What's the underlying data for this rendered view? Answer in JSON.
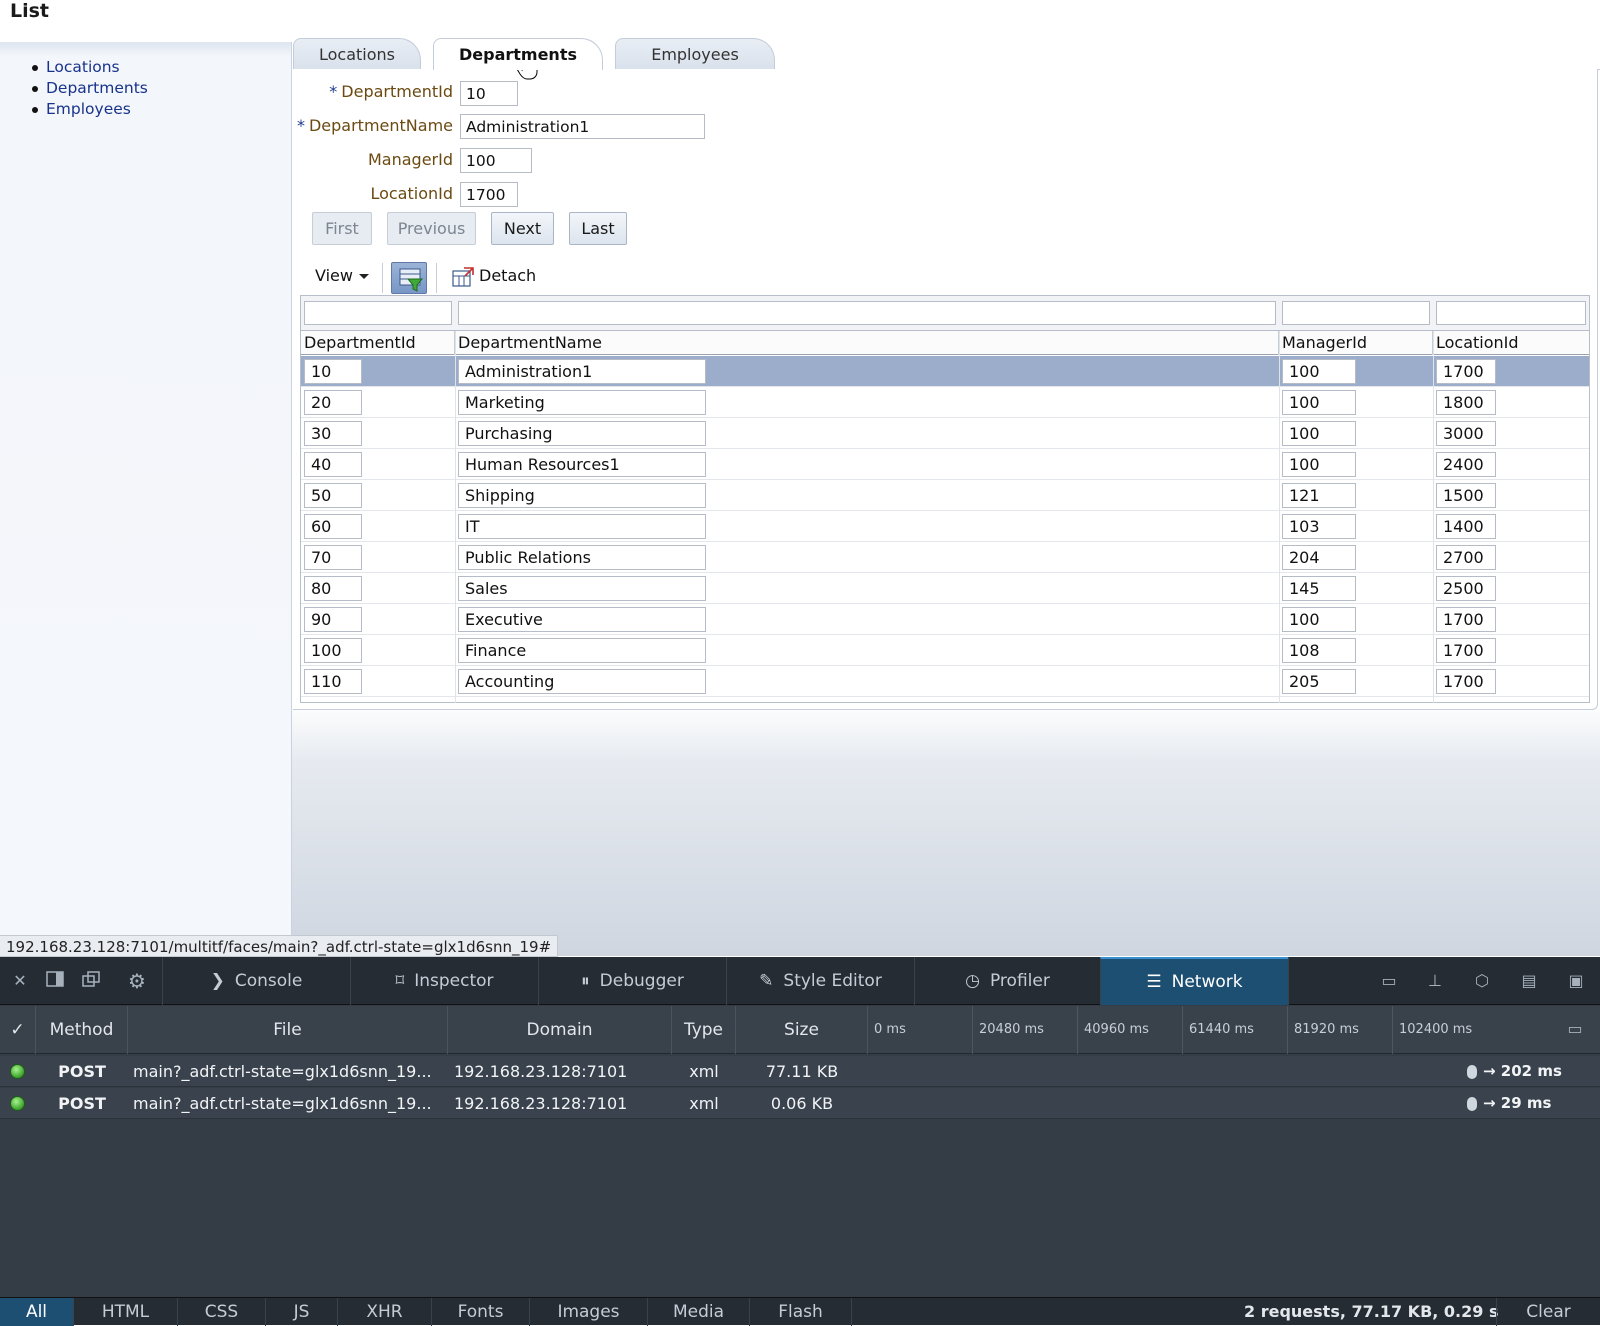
{
  "page": {
    "title": "List"
  },
  "sidebar": {
    "items": [
      {
        "label": "Locations"
      },
      {
        "label": "Departments"
      },
      {
        "label": "Employees"
      }
    ]
  },
  "tabs": [
    {
      "label": "Locations"
    },
    {
      "label": "Departments",
      "active": true
    },
    {
      "label": "Employees"
    }
  ],
  "form": {
    "required_mark": "*",
    "fields": [
      {
        "label": "DepartmentId",
        "value": "10",
        "required": true
      },
      {
        "label": "DepartmentName",
        "value": "Administration1",
        "required": true
      },
      {
        "label": "ManagerId",
        "value": "100",
        "required": false
      },
      {
        "label": "LocationId",
        "value": "1700",
        "required": false
      }
    ]
  },
  "nav_buttons": {
    "first": "First",
    "previous": "Previous",
    "next": "Next",
    "last": "Last"
  },
  "toolbar": {
    "view": "View",
    "detach": "Detach"
  },
  "table": {
    "columns": [
      "DepartmentId",
      "DepartmentName",
      "ManagerId",
      "LocationId"
    ],
    "rows": [
      [
        "10",
        "Administration1",
        "100",
        "1700"
      ],
      [
        "20",
        "Marketing",
        "100",
        "1800"
      ],
      [
        "30",
        "Purchasing",
        "100",
        "3000"
      ],
      [
        "40",
        "Human Resources1",
        "100",
        "2400"
      ],
      [
        "50",
        "Shipping",
        "121",
        "1500"
      ],
      [
        "60",
        "IT",
        "103",
        "1400"
      ],
      [
        "70",
        "Public Relations",
        "204",
        "2700"
      ],
      [
        "80",
        "Sales",
        "145",
        "2500"
      ],
      [
        "90",
        "Executive",
        "100",
        "1700"
      ],
      [
        "100",
        "Finance",
        "108",
        "1700"
      ],
      [
        "110",
        "Accounting",
        "205",
        "1700"
      ]
    ],
    "selected_row": 0
  },
  "status_bar": {
    "url": "192.168.23.128:7101/multitf/faces/main?_adf.ctrl-state=glx1d6snn_19#"
  },
  "devtools": {
    "tabs": [
      "Console",
      "Inspector",
      "Debugger",
      "Style Editor",
      "Profiler",
      "Network"
    ],
    "active_tab": "Network",
    "columns": {
      "check": "✓",
      "method": "Method",
      "file": "File",
      "domain": "Domain",
      "type": "Type",
      "size": "Size"
    },
    "ticks": [
      "0 ms",
      "20480 ms",
      "40960 ms",
      "61440 ms",
      "81920 ms",
      "102400 ms"
    ],
    "requests": [
      {
        "method": "POST",
        "file": "main?_adf.ctrl-state=glx1d6snn_19...",
        "domain": "192.168.23.128:7101",
        "type": "xml",
        "size": "77.11 KB",
        "timing": "→ 202 ms"
      },
      {
        "method": "POST",
        "file": "main?_adf.ctrl-state=glx1d6snn_19...",
        "domain": "192.168.23.128:7101",
        "type": "xml",
        "size": "0.06 KB",
        "timing": "→ 29 ms"
      }
    ],
    "filters": [
      "All",
      "HTML",
      "CSS",
      "JS",
      "XHR",
      "Fonts",
      "Images",
      "Media",
      "Flash"
    ],
    "active_filter": "All",
    "summary": "2 requests, 77.17 KB, 0.29 s",
    "clear": "Clear"
  },
  "colors": {
    "link": "#18338c",
    "label": "#6b4a12",
    "selected_row": "#9cadcb",
    "devtools_bg": "#343c45",
    "devtools_active": "#1d4f73"
  },
  "icons": [
    "close-icon",
    "dock-side-icon",
    "split-window-icon",
    "gear-icon",
    "console-icon",
    "inspector-icon",
    "debugger-icon",
    "style-editor-icon",
    "profiler-icon",
    "network-icon",
    "filter-icon",
    "detach-icon",
    "status-dot-icon",
    "pointer-cursor-icon"
  ]
}
